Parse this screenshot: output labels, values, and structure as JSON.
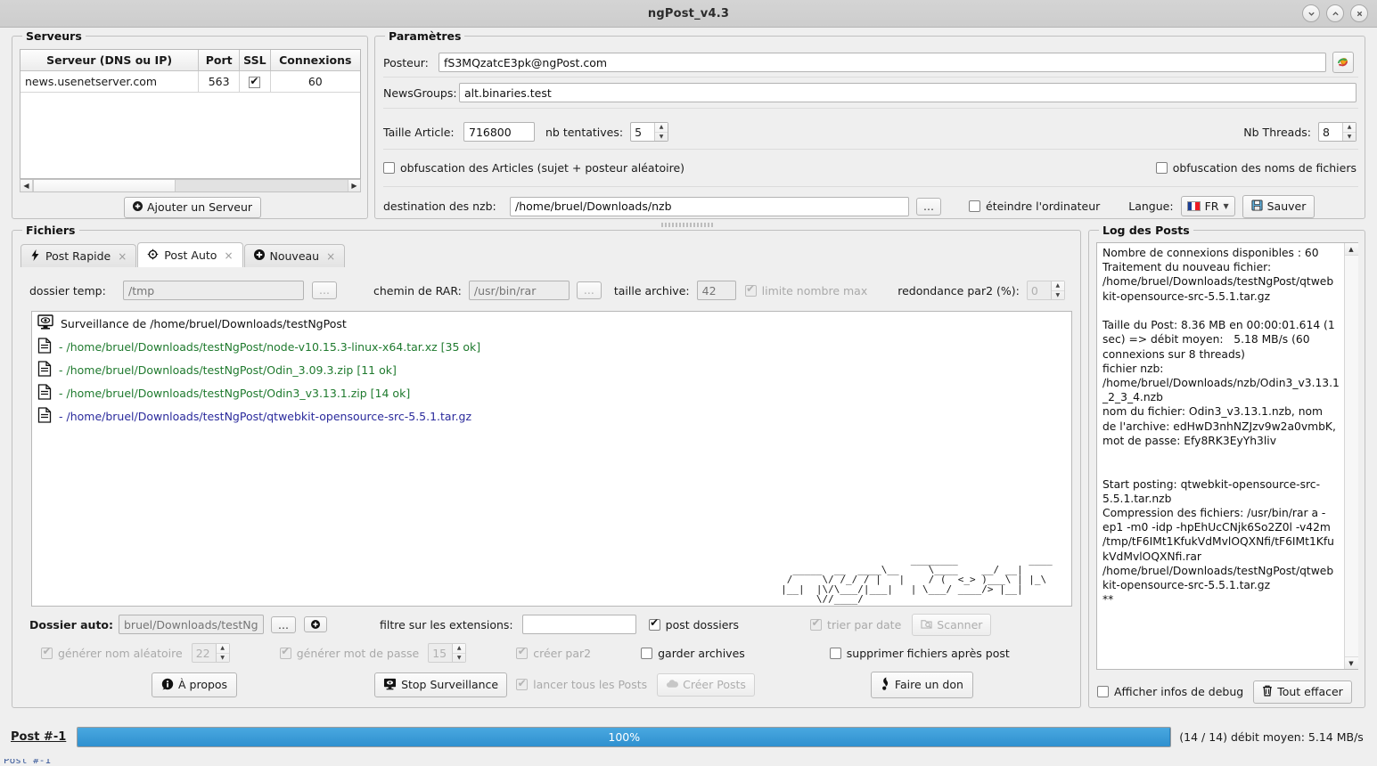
{
  "window": {
    "title": "ngPost_v4.3",
    "buttons": {
      "minimize": "minimize-icon",
      "maximize": "maximize-icon",
      "close": "close-icon"
    }
  },
  "servers": {
    "legend": "Serveurs",
    "columns": [
      "Serveur (DNS ou IP)",
      "Port",
      "SSL",
      "Connexions"
    ],
    "rows": [
      {
        "host": "news.usenetserver.com",
        "port": "563",
        "ssl": true,
        "connections": "60"
      }
    ],
    "add_button": "Ajouter un Serveur"
  },
  "params": {
    "legend": "Paramètres",
    "poster_label": "Posteur:",
    "poster_value": "fS3MQzatcE3pk@ngPost.com",
    "refresh_icon": "refresh-poster-icon",
    "newsgroups_label": "NewsGroups:",
    "newsgroups_value": "alt.binaries.test",
    "article_size_label": "Taille Article:",
    "article_size_value": "716800",
    "retries_label": "nb tentatives:",
    "retries_value": "5",
    "threads_label": "Nb Threads:",
    "threads_value": "8",
    "obfuscate_articles_label": "obfuscation des Articles (sujet + posteur aléatoire)",
    "obfuscate_articles_checked": false,
    "obfuscate_filenames_label": "obfuscation des noms de fichiers",
    "obfuscate_filenames_checked": false,
    "nzb_dest_label": "destination des nzb:",
    "nzb_dest_value": "/home/bruel/Downloads/nzb",
    "browse_label": "...",
    "shutdown_label": "éteindre l'ordinateur",
    "shutdown_checked": false,
    "lang_label": "Langue:",
    "lang_value": "FR",
    "save_label": "Sauver"
  },
  "files": {
    "legend": "Fichiers",
    "tabs": [
      {
        "label": "Post Rapide",
        "icon": "lightning-icon",
        "active": false,
        "close": "×"
      },
      {
        "label": "Post Auto",
        "icon": "auto-post-icon",
        "active": true,
        "close": "×"
      },
      {
        "label": "Nouveau",
        "icon": "plus-circle-icon",
        "active": false,
        "close": "×"
      }
    ],
    "temp_dir_label": "dossier temp:",
    "temp_dir_placeholder": "/tmp",
    "temp_dir_browse": "...",
    "rar_path_label": "chemin de RAR:",
    "rar_path_placeholder": "/usr/bin/rar",
    "rar_path_browse": "...",
    "archive_size_label": "taille archive:",
    "archive_size_value": "42",
    "limit_max_label": "limite nombre max",
    "limit_max_checked": true,
    "par2_redundancy_label": "redondance par2 (%):",
    "par2_redundancy_value": "0",
    "list": [
      {
        "icon": "monitor-watch-icon",
        "text": "Surveillance de /home/bruel/Downloads/testNgPost",
        "state": "root"
      },
      {
        "icon": "file-icon",
        "text": "- /home/bruel/Downloads/testNgPost/node-v10.15.3-linux-x64.tar.xz [35 ok]",
        "state": "ok"
      },
      {
        "icon": "file-icon",
        "text": "- /home/bruel/Downloads/testNgPost/Odin_3.09.3.zip [11 ok]",
        "state": "ok"
      },
      {
        "icon": "file-icon",
        "text": "- /home/bruel/Downloads/testNgPost/Odin3_v3.13.1.zip [14 ok]",
        "state": "ok"
      },
      {
        "icon": "file-icon",
        "text": "- /home/bruel/Downloads/testNgPost/qtwebkit-opensource-src-5.5.1.tar.gz",
        "state": "pending"
      }
    ],
    "ascii_logo": "                      ________            ____  \n  _____  __  ____\\__     \\____    __/ __| \n /     \\/ /_/ / |   |    / (  <_> )___\\ | |_\\\n|__|  |\\/\\___/|___|   | \\___/ ____/> |__|\n      \\//____/",
    "auto_dir_label": "Dossier auto:",
    "auto_dir_placeholder": "bruel/Downloads/testNgPost",
    "auto_dir_browse": "...",
    "auto_dir_add": "add-icon",
    "ext_filter_label": "filtre sur les extensions:",
    "ext_filter_value": "",
    "post_folders_label": "post dossiers",
    "post_folders_checked": true,
    "sort_by_date_label": "trier par date",
    "sort_by_date_checked": true,
    "scan_label": "Scanner",
    "random_name_label": "générer nom aléatoire",
    "random_name_checked": true,
    "random_name_value": "22",
    "random_pass_label": "générer mot de passe",
    "random_pass_checked": true,
    "random_pass_value": "15",
    "create_par2_label": "créer par2",
    "create_par2_checked": true,
    "keep_archives_label": "garder archives",
    "keep_archives_checked": false,
    "delete_after_label": "supprimer fichiers après post",
    "delete_after_checked": false,
    "about_label": "À propos",
    "stop_watch_label": "Stop Surveillance",
    "launch_all_label": "lancer tous les Posts",
    "launch_all_checked": true,
    "create_posts_label": "Créer Posts",
    "donate_label": "Faire un don"
  },
  "log": {
    "legend": "Log des Posts",
    "content": "Nombre de connexions disponibles : 60\nTraitement du nouveau fichier: /home/bruel/Downloads/testNgPost/qtwebkit-opensource-src-5.5.1.tar.gz\n\nTaille du Post: 8.36 MB en 00:00:01.614 (1 sec) => débit moyen:   5.18 MB/s (60 connexions sur 8 threads)\nfichier nzb: /home/bruel/Downloads/nzb/Odin3_v3.13.1_2_3_4.nzb\nnom du fichier: Odin3_v3.13.1.nzb, nom de l'archive: edHwD3nhNZJzv9w2a0vmbK, mot de passe: Efy8RK3EyYh3liv\n\n\nStart posting: qtwebkit-opensource-src-5.5.1.tar.nzb\nCompression des fichiers: /usr/bin/rar a -ep1 -m0 -idp -hpEhUcCNjk6So2Z0l -v42m /tmp/tF6IMt1KfukVdMvlOQXNfi/tF6IMt1KfukVdMvlOQXNfi.rar /home/bruel/Downloads/testNgPost/qtwebkit-opensource-src-5.5.1.tar.gz\n**",
    "debug_label": "Afficher infos de debug",
    "debug_checked": false,
    "clear_label": "Tout effacer"
  },
  "status": {
    "post_label": "Post #-1",
    "progress_percent": "100%",
    "progress_value": 100,
    "summary": "(14 / 14) débit moyen:  5.14 MB/s",
    "accent_color": "#3b9ad8"
  }
}
